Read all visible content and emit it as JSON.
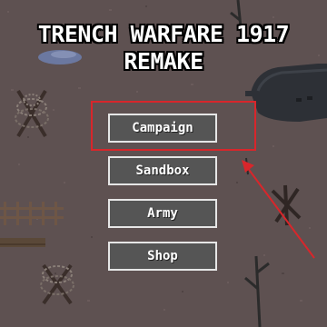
{
  "title": {
    "line1": "TRENCH WARFARE 1917",
    "line2": "REMAKE"
  },
  "menu": {
    "campaign_label": "Campaign",
    "sandbox_label": "Sandbox",
    "army_label": "Army",
    "shop_label": "Shop"
  },
  "annotation": {
    "color": "#d8262b",
    "highlighted_item": "campaign"
  },
  "colors": {
    "ground": "#5e5151",
    "button_fill": "#555555",
    "button_border": "#e6e6e6",
    "title_text": "#ffffff"
  },
  "scenery_icons": [
    "dead-tree-icon",
    "barbed-wire-icon",
    "czech-hedgehog-icon",
    "tank-icon",
    "wooden-fence-icon",
    "puddle-icon"
  ]
}
